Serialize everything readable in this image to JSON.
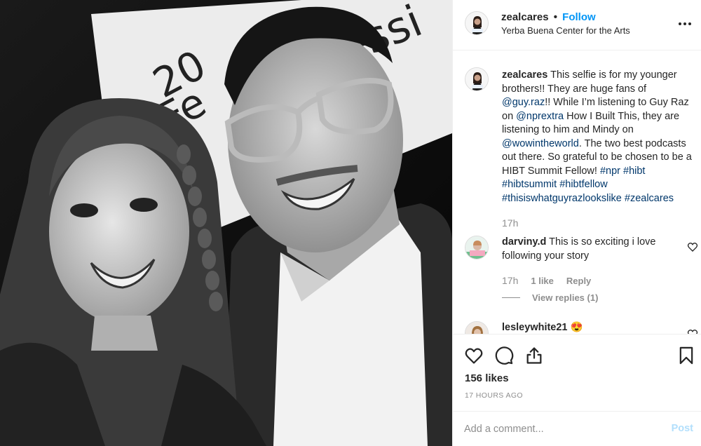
{
  "photo": {
    "alt": "Black and white selfie of a smiling girl with braids and a smiling man in glasses in front of a banner",
    "banner_text_1": "20",
    "banner_text_2": "Fe",
    "banner_text_3": "essi"
  },
  "header": {
    "username": "zealcares",
    "separator": "•",
    "follow_label": "Follow",
    "location": "Yerba Buena Center for the Arts",
    "more_icon": "more-horizontal-icon"
  },
  "caption": {
    "username": "zealcares",
    "text_1": "This selfie is for my younger brothers!! They are huge fans of",
    "mention_1": "@guy.raz",
    "text_2": "!! While I’m listening to Guy Raz on",
    "mention_2": "@nprextra",
    "text_3": "How I Built This, they are listening to him and Mindy on",
    "mention_3": "@wowintheworld",
    "text_4": ". The two best podcasts out there. So grateful to be chosen to be a HIBT Summit Fellow!",
    "hashtags": [
      "#npr",
      "#hibt",
      "#hibtsummit",
      "#hibtfellow",
      "#thisiswhatguyrazlookslike",
      "#zealcares"
    ],
    "time": "17h"
  },
  "comments": [
    {
      "username": "darviny.d",
      "text": "This is so exciting i love following your story",
      "time": "17h",
      "likes": "1 like",
      "reply_label": "Reply",
      "view_replies": "View replies (1)"
    },
    {
      "username": "lesleywhite21",
      "text": "😍"
    }
  ],
  "actions": {
    "like_icon": "heart-icon",
    "comment_icon": "comment-icon",
    "share_icon": "share-icon",
    "save_icon": "bookmark-icon",
    "likes_count": "156 likes",
    "time_ago": "17 HOURS AGO"
  },
  "add_comment": {
    "placeholder": "Add a comment...",
    "post_label": "Post"
  },
  "colors": {
    "link_blue": "#0095f6",
    "tag_blue": "#00376b",
    "muted": "#8e8e8e",
    "post_disabled": "#b2dffc"
  }
}
